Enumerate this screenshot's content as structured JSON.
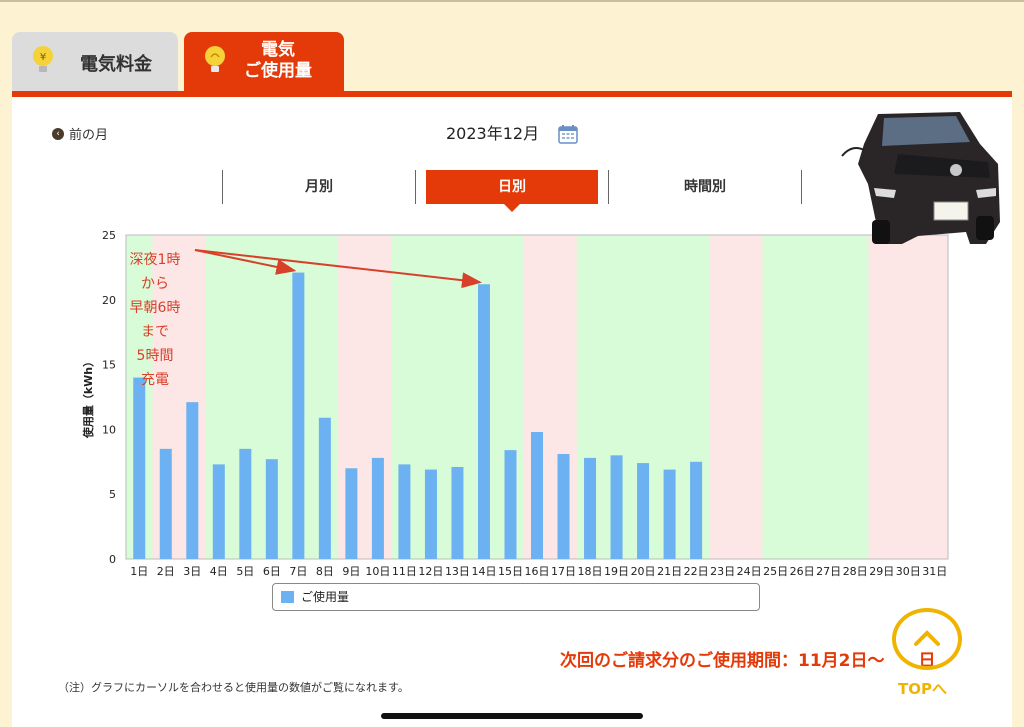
{
  "tabs": [
    {
      "label": "電気料金",
      "icon": "yen-bulb-icon",
      "active": false
    },
    {
      "label_line1": "電気",
      "label_line2": "ご使用量",
      "icon": "bulb-icon",
      "active": true
    }
  ],
  "prev_month_label": "前の月",
  "current_month": "2023年12月",
  "view_tabs": [
    {
      "label": "月別",
      "active": false
    },
    {
      "label": "日別",
      "active": true
    },
    {
      "label": "時間別",
      "active": false
    }
  ],
  "annotation": [
    "深夜1時",
    "から",
    "早朝6時",
    "まで",
    "5時間",
    "充電"
  ],
  "billing_period": "次回のご請求分のご使用期間：11月2日～　　日",
  "note": "（注）グラフにカーソルを合わせると使用量の数値がご覧になれます。",
  "top_button_label": "TOPへ",
  "colors": {
    "accent": "#e43a09",
    "bar": "#6cb1f1",
    "weekday_bg": "#d8fcd8",
    "weekend_bg": "#fde6e6",
    "annotation": "#d8402a",
    "top_button": "#f0b400"
  },
  "chart_data": {
    "type": "bar",
    "ylabel": "使用量（kWh）",
    "ylim": [
      0,
      25
    ],
    "yticks": [
      0,
      5,
      10,
      15,
      20,
      25
    ],
    "categories": [
      "1日",
      "2日",
      "3日",
      "4日",
      "5日",
      "6日",
      "7日",
      "8日",
      "9日",
      "10日",
      "11日",
      "12日",
      "13日",
      "14日",
      "15日",
      "16日",
      "17日",
      "18日",
      "19日",
      "20日",
      "21日",
      "22日",
      "23日",
      "24日",
      "25日",
      "26日",
      "27日",
      "28日",
      "29日",
      "30日",
      "31日"
    ],
    "series": [
      {
        "name": "ご使用量",
        "values": [
          14.0,
          8.5,
          12.1,
          7.3,
          8.5,
          7.7,
          22.1,
          10.9,
          7.0,
          7.8,
          7.3,
          6.9,
          7.1,
          21.2,
          8.4,
          9.8,
          8.1,
          7.8,
          8.0,
          7.4,
          6.9,
          7.5,
          null,
          null,
          null,
          null,
          null,
          null,
          null,
          null,
          null
        ]
      }
    ],
    "day_shading": [
      "weekday",
      "weekend",
      "weekend",
      "weekday",
      "weekday",
      "weekday",
      "weekday",
      "weekday",
      "weekend",
      "weekend",
      "weekday",
      "weekday",
      "weekday",
      "weekday",
      "weekday",
      "weekend",
      "weekend",
      "weekday",
      "weekday",
      "weekday",
      "weekday",
      "weekday",
      "weekend",
      "weekend",
      "weekday",
      "weekday",
      "weekday",
      "weekday",
      "weekend",
      "weekend",
      "weekend"
    ],
    "grid": false,
    "legend": "bottom"
  }
}
